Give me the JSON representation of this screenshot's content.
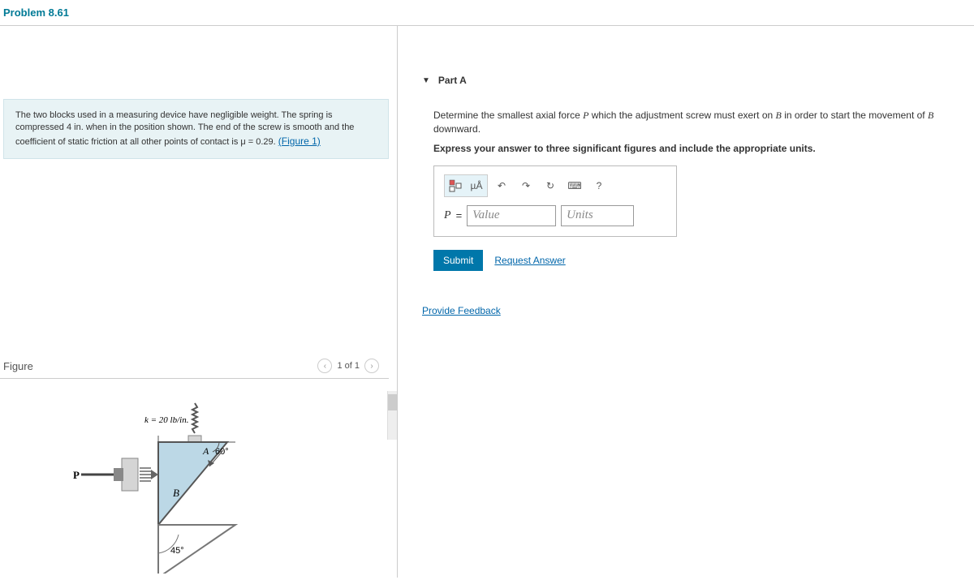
{
  "header": {
    "title": "Problem 8.61"
  },
  "problem": {
    "text_before_link": "The two blocks used in a measuring device have negligible weight. The spring is compressed 4 in. when in the position shown. The end of the screw is smooth and the coefficient of static friction at all other points of contact is μ = 0.29. ",
    "link": "(Figure 1)"
  },
  "figure": {
    "label": "Figure",
    "pager_text": "1 of 1",
    "diag": {
      "k": "k = 20 lb/in.",
      "A": "A",
      "ang60": "60°",
      "P": "P",
      "B": "B",
      "ang45": "45°"
    }
  },
  "part": {
    "label": "Part A",
    "question_before": "Determine the smallest axial force ",
    "P": "P",
    "question_mid": " which the adjustment screw must exert on ",
    "B1": "B",
    "question_mid2": " in order to start the movement of ",
    "B2": "B",
    "question_after": " downward.",
    "instruction": "Express your answer to three significant figures and include the appropriate units."
  },
  "toolbar": {
    "templates": "▯▯",
    "units": "µÅ",
    "undo": "↶",
    "redo": "↷",
    "reset": "↻",
    "keyboard": "⌨",
    "help": "?"
  },
  "answer": {
    "var": "P",
    "eq": "=",
    "value_ph": "Value",
    "units_ph": "Units"
  },
  "actions": {
    "submit": "Submit",
    "request": "Request Answer"
  },
  "feedback": {
    "link": "Provide Feedback"
  }
}
